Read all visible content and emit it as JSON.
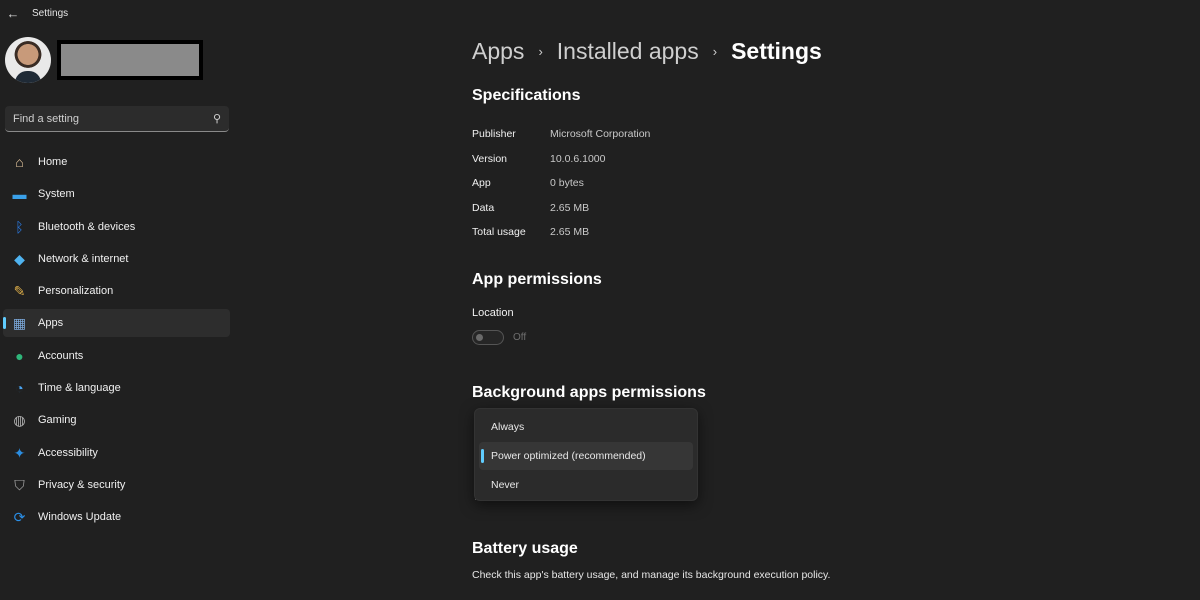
{
  "window": {
    "title": "Settings",
    "back_icon": "←"
  },
  "profile": {
    "name_redacted": true
  },
  "search": {
    "placeholder": "Find a setting",
    "value": "",
    "icon": "⚲"
  },
  "sidebar": {
    "items": [
      {
        "label": "Home",
        "icon": "home-icon",
        "glyph": "⌂",
        "color": "#e8c9a0",
        "active": false
      },
      {
        "label": "System",
        "icon": "system-icon",
        "glyph": "▬",
        "color": "#3aa0e8",
        "active": false
      },
      {
        "label": "Bluetooth & devices",
        "icon": "bluetooth-icon",
        "glyph": "ᛒ",
        "color": "#2b7de9",
        "active": false
      },
      {
        "label": "Network & internet",
        "icon": "wifi-icon",
        "glyph": "◆",
        "color": "#4fb3f0",
        "active": false
      },
      {
        "label": "Personalization",
        "icon": "brush-icon",
        "glyph": "✎",
        "color": "#e0b04a",
        "active": false
      },
      {
        "label": "Apps",
        "icon": "apps-icon",
        "glyph": "▦",
        "color": "#7aa7d8",
        "active": true
      },
      {
        "label": "Accounts",
        "icon": "accounts-icon",
        "glyph": "●",
        "color": "#2fb67a",
        "active": false
      },
      {
        "label": "Time & language",
        "icon": "globe-clock-icon",
        "glyph": "◔",
        "color": "#4aa3f0",
        "active": false
      },
      {
        "label": "Gaming",
        "icon": "gamepad-icon",
        "glyph": "◍",
        "color": "#b5b5b5",
        "active": false
      },
      {
        "label": "Accessibility",
        "icon": "accessibility-icon",
        "glyph": "✦",
        "color": "#2b8de0",
        "active": false
      },
      {
        "label": "Privacy & security",
        "icon": "shield-icon",
        "glyph": "⛉",
        "color": "#a8a8a8",
        "active": false
      },
      {
        "label": "Windows Update",
        "icon": "update-icon",
        "glyph": "⟳",
        "color": "#2a8fe8",
        "active": false
      }
    ]
  },
  "breadcrumb": {
    "items": [
      "Apps",
      "Installed apps",
      "Settings"
    ],
    "separator": "›"
  },
  "specifications": {
    "title": "Specifications",
    "rows": [
      {
        "key": "Publisher",
        "value": "Microsoft Corporation"
      },
      {
        "key": "Version",
        "value": "10.0.6.1000"
      },
      {
        "key": "App",
        "value": "0 bytes"
      },
      {
        "key": "Data",
        "value": "2.65 MB"
      },
      {
        "key": "Total usage",
        "value": "2.65 MB"
      }
    ]
  },
  "app_permissions": {
    "title": "App permissions",
    "location_label": "Location",
    "location_state": "Off",
    "location_enabled": false
  },
  "background_permissions": {
    "title": "Background apps permissions",
    "options": [
      "Always",
      "Power optimized (recommended)",
      "Never"
    ],
    "selected": "Power optimized (recommended)"
  },
  "battery_usage": {
    "title": "Battery usage",
    "description": "Check this app's battery usage, and manage its background execution policy."
  },
  "colors": {
    "accent": "#60cdff",
    "background": "#202020"
  }
}
